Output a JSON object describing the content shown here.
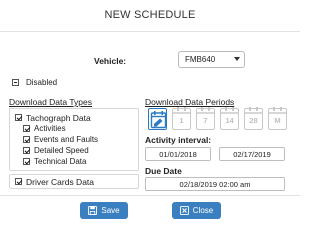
{
  "title": "NEW SCHEDULE",
  "vehicle": {
    "label": "Vehicle:",
    "value": "FMB640"
  },
  "disabled": {
    "label": "Disabled"
  },
  "download_types": {
    "heading": "Download Data Types",
    "items": [
      {
        "label": "Tachograph Data",
        "checked": true
      },
      {
        "label": "Activities",
        "checked": true
      },
      {
        "label": "Events and Faults",
        "checked": true
      },
      {
        "label": "Detailed Speed",
        "checked": true
      },
      {
        "label": "Technical Data",
        "checked": true
      }
    ],
    "driver_cards": {
      "label": "Driver Cards Data",
      "checked": true
    }
  },
  "download_periods": {
    "heading": "Download Data Periods",
    "options": [
      {
        "label": "",
        "icon": "calendar-icon",
        "active": true
      },
      {
        "label": "1",
        "active": false
      },
      {
        "label": "7",
        "active": false
      },
      {
        "label": "14",
        "active": false
      },
      {
        "label": "28",
        "active": false
      },
      {
        "label": "M",
        "active": false
      }
    ]
  },
  "activity_interval": {
    "label": "Activity interval:",
    "from": "01/01/2018",
    "to": "02/17/2019"
  },
  "due_date": {
    "label": "Due Date",
    "value": "02/18/2019 02:00 am"
  },
  "buttons": {
    "save": {
      "label": "Save",
      "icon": "save-icon"
    },
    "close": {
      "label": "Close",
      "icon": "close-icon"
    }
  },
  "colors": {
    "accent": "#3a7fc0",
    "active_period": "#2b7bc2"
  }
}
